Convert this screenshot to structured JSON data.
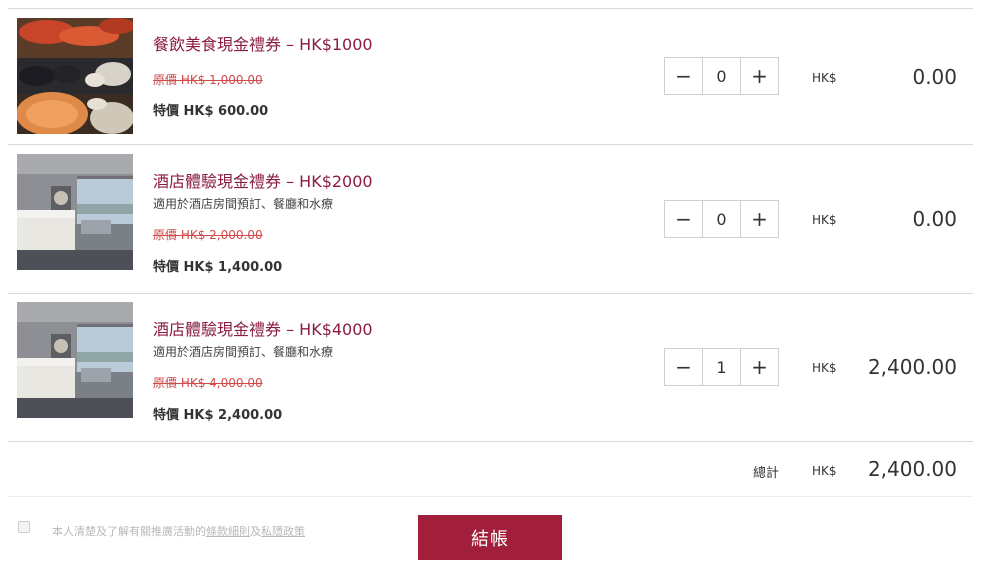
{
  "cart": {
    "items": [
      {
        "title": "餐飲美食現金禮券 – HK$1000",
        "description": "",
        "original_price": "原價 HK$ 1,000.00",
        "special_price": "特價 HK$ 600.00",
        "quantity": "0",
        "currency": "HK$",
        "amount": "0.00",
        "image": "seafood-buffet-image"
      },
      {
        "title": "酒店體驗現金禮券 – HK$2000",
        "description": "適用於酒店房間預訂、餐廳和水療",
        "original_price": "原價 HK$ 2,000.00",
        "special_price": "特價 HK$ 1,400.00",
        "quantity": "0",
        "currency": "HK$",
        "amount": "0.00",
        "image": "hotel-room-image"
      },
      {
        "title": "酒店體驗現金禮券 – HK$4000",
        "description": "適用於酒店房間預訂、餐廳和水療",
        "original_price": "原價 HK$ 4,000.00",
        "special_price": "特價 HK$ 2,400.00",
        "quantity": "1",
        "currency": "HK$",
        "amount": "2,400.00",
        "image": "hotel-room-image"
      }
    ],
    "stepper": {
      "minus": "−",
      "plus": "+"
    },
    "total": {
      "label": "總計",
      "currency": "HK$",
      "amount": "2,400.00"
    }
  },
  "footer": {
    "agree_prefix": "本人清楚及了解有關推廣活動的",
    "terms_link": "條款細則",
    "and": "及",
    "privacy_link": "私隱政策",
    "checkout_label": "結帳"
  },
  "colors": {
    "title": "#8b1e3f",
    "strike": "#d24b4b",
    "checkout_bg": "#a11f3a",
    "divider": "#d9d9d9"
  }
}
